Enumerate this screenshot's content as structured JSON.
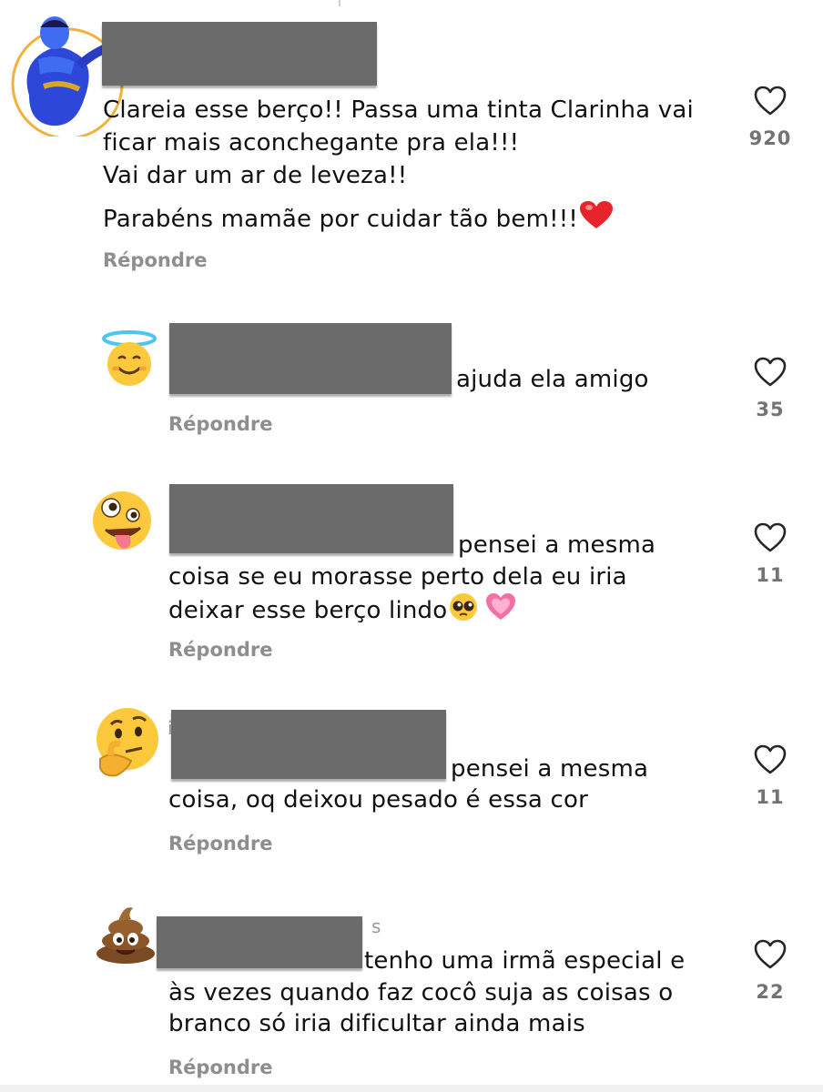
{
  "reply_label": "Répondre",
  "comments": [
    {
      "avatar_icon": "genie-icon",
      "lines": [
        "Clareia esse berço!! Passa uma tinta Clarinha vai",
        "ficar mais aconchegante pra ela!!!",
        "Vai dar um ar de leveza!!",
        "Parabéns mamãe por cuidar tão bem!!!"
      ],
      "trailing_emoji": "red-heart-emoji",
      "likes": "920"
    },
    {
      "avatar_icon": "smiling-face-with-halo-icon",
      "lines": [
        "ajuda  ela amigo"
      ],
      "likes": "35"
    },
    {
      "avatar_icon": "zany-face-icon",
      "lines": [
        "pensei a mesma",
        "coisa se eu morasse perto dela eu iria",
        "deixar esse berço lindo"
      ],
      "trailing_emoji": [
        "pleading-face-emoji",
        "growing-heart-emoji"
      ],
      "likes": "11"
    },
    {
      "avatar_icon": "thinking-face-icon",
      "lines": [
        "pensei a mesma",
        "coisa, oq deixou pesado é essa cor"
      ],
      "likes": "11"
    },
    {
      "avatar_icon": "pile-of-poo-icon",
      "timestamp": "s",
      "lines": [
        "tenho uma irmã especial e",
        "às vezes quando faz cocô suja as coisas o",
        "branco só iria dificultar ainda mais"
      ],
      "likes": "22"
    }
  ],
  "colors": {
    "text": "#111111",
    "secondary": "#8e8e8e",
    "redaction": "#6b6b6b",
    "heart_outline": "#262626"
  }
}
